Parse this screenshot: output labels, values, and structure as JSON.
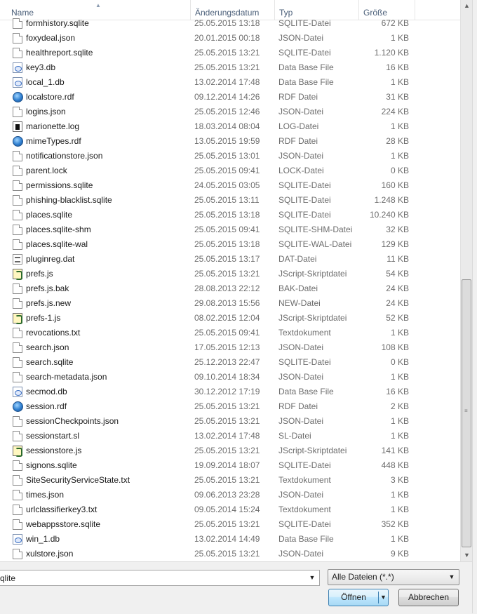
{
  "columns": {
    "name": "Name",
    "date": "Änderungsdatum",
    "type": "Typ",
    "size": "Größe"
  },
  "files": [
    {
      "name": "formhistory.sqlite",
      "date": "25.05.2015 13:18",
      "type": "SQLITE-Datei",
      "size": "672 KB",
      "icon": "doc-icon"
    },
    {
      "name": "foxydeal.json",
      "date": "20.01.2015 00:18",
      "type": "JSON-Datei",
      "size": "1 KB",
      "icon": "doc-icon"
    },
    {
      "name": "healthreport.sqlite",
      "date": "25.05.2015 13:21",
      "type": "SQLITE-Datei",
      "size": "1.120 KB",
      "icon": "doc-icon"
    },
    {
      "name": "key3.db",
      "date": "25.05.2015 13:21",
      "type": "Data Base File",
      "size": "16 KB",
      "icon": "database-file-icon"
    },
    {
      "name": "local_1.db",
      "date": "13.02.2014 17:48",
      "type": "Data Base File",
      "size": "1 KB",
      "icon": "database-file-icon"
    },
    {
      "name": "localstore.rdf",
      "date": "09.12.2014 14:26",
      "type": "RDF Datei",
      "size": "31 KB",
      "icon": "rdf-globe-icon"
    },
    {
      "name": "logins.json",
      "date": "25.05.2015 12:46",
      "type": "JSON-Datei",
      "size": "224 KB",
      "icon": "doc-icon"
    },
    {
      "name": "marionette.log",
      "date": "18.03.2014 08:04",
      "type": "LOG-Datei",
      "size": "1 KB",
      "icon": "log-file-icon"
    },
    {
      "name": "mimeTypes.rdf",
      "date": "13.05.2015 19:59",
      "type": "RDF Datei",
      "size": "28 KB",
      "icon": "rdf-globe-icon"
    },
    {
      "name": "notificationstore.json",
      "date": "25.05.2015 13:01",
      "type": "JSON-Datei",
      "size": "1 KB",
      "icon": "doc-icon"
    },
    {
      "name": "parent.lock",
      "date": "25.05.2015 09:41",
      "type": "LOCK-Datei",
      "size": "0 KB",
      "icon": "doc-icon"
    },
    {
      "name": "permissions.sqlite",
      "date": "24.05.2015 03:05",
      "type": "SQLITE-Datei",
      "size": "160 KB",
      "icon": "doc-icon"
    },
    {
      "name": "phishing-blacklist.sqlite",
      "date": "25.05.2015 13:11",
      "type": "SQLITE-Datei",
      "size": "1.248 KB",
      "icon": "doc-icon"
    },
    {
      "name": "places.sqlite",
      "date": "25.05.2015 13:18",
      "type": "SQLITE-Datei",
      "size": "10.240 KB",
      "icon": "doc-icon"
    },
    {
      "name": "places.sqlite-shm",
      "date": "25.05.2015 09:41",
      "type": "SQLITE-SHM-Datei",
      "size": "32 KB",
      "icon": "doc-icon"
    },
    {
      "name": "places.sqlite-wal",
      "date": "25.05.2015 13:18",
      "type": "SQLITE-WAL-Datei",
      "size": "129 KB",
      "icon": "doc-icon"
    },
    {
      "name": "pluginreg.dat",
      "date": "25.05.2015 13:17",
      "type": "DAT-Datei",
      "size": "11 KB",
      "icon": "dat-file-icon"
    },
    {
      "name": "prefs.js",
      "date": "25.05.2015 13:21",
      "type": "JScript-Skriptdatei",
      "size": "54 KB",
      "icon": "jscript-file-icon"
    },
    {
      "name": "prefs.js.bak",
      "date": "28.08.2013 22:12",
      "type": "BAK-Datei",
      "size": "24 KB",
      "icon": "doc-icon"
    },
    {
      "name": "prefs.js.new",
      "date": "29.08.2013 15:56",
      "type": "NEW-Datei",
      "size": "24 KB",
      "icon": "doc-icon"
    },
    {
      "name": "prefs-1.js",
      "date": "08.02.2015 12:04",
      "type": "JScript-Skriptdatei",
      "size": "52 KB",
      "icon": "jscript-file-icon"
    },
    {
      "name": "revocations.txt",
      "date": "25.05.2015 09:41",
      "type": "Textdokument",
      "size": "1 KB",
      "icon": "doc-icon"
    },
    {
      "name": "search.json",
      "date": "17.05.2015 12:13",
      "type": "JSON-Datei",
      "size": "108 KB",
      "icon": "doc-icon"
    },
    {
      "name": "search.sqlite",
      "date": "25.12.2013 22:47",
      "type": "SQLITE-Datei",
      "size": "0 KB",
      "icon": "doc-icon"
    },
    {
      "name": "search-metadata.json",
      "date": "09.10.2014 18:34",
      "type": "JSON-Datei",
      "size": "1 KB",
      "icon": "doc-icon"
    },
    {
      "name": "secmod.db",
      "date": "30.12.2012 17:19",
      "type": "Data Base File",
      "size": "16 KB",
      "icon": "database-file-icon"
    },
    {
      "name": "session.rdf",
      "date": "25.05.2015 13:21",
      "type": "RDF Datei",
      "size": "2 KB",
      "icon": "rdf-globe-icon"
    },
    {
      "name": "sessionCheckpoints.json",
      "date": "25.05.2015 13:21",
      "type": "JSON-Datei",
      "size": "1 KB",
      "icon": "doc-icon"
    },
    {
      "name": "sessionstart.sl",
      "date": "13.02.2014 17:48",
      "type": "SL-Datei",
      "size": "1 KB",
      "icon": "doc-icon"
    },
    {
      "name": "sessionstore.js",
      "date": "25.05.2015 13:21",
      "type": "JScript-Skriptdatei",
      "size": "141 KB",
      "icon": "jscript-file-icon"
    },
    {
      "name": "signons.sqlite",
      "date": "19.09.2014 18:07",
      "type": "SQLITE-Datei",
      "size": "448 KB",
      "icon": "doc-icon"
    },
    {
      "name": "SiteSecurityServiceState.txt",
      "date": "25.05.2015 13:21",
      "type": "Textdokument",
      "size": "3 KB",
      "icon": "doc-icon"
    },
    {
      "name": "times.json",
      "date": "09.06.2013 23:28",
      "type": "JSON-Datei",
      "size": "1 KB",
      "icon": "doc-icon"
    },
    {
      "name": "urlclassifierkey3.txt",
      "date": "09.05.2014 15:24",
      "type": "Textdokument",
      "size": "1 KB",
      "icon": "doc-icon"
    },
    {
      "name": "webappsstore.sqlite",
      "date": "25.05.2015 13:21",
      "type": "SQLITE-Datei",
      "size": "352 KB",
      "icon": "doc-icon"
    },
    {
      "name": "win_1.db",
      "date": "13.02.2014 14:49",
      "type": "Data Base File",
      "size": "1 KB",
      "icon": "database-file-icon"
    },
    {
      "name": "xulstore.json",
      "date": "25.05.2015 13:21",
      "type": "JSON-Datei",
      "size": "9 KB",
      "icon": "doc-icon"
    }
  ],
  "filename_field": {
    "value": "qlite"
  },
  "filetype_select": {
    "selected": "Alle Dateien (*.*)"
  },
  "buttons": {
    "open": "Öffnen",
    "cancel": "Abbrechen"
  },
  "icons": {
    "sort": "sort-ascending-icon",
    "close": "close-icon",
    "scroll_up": "scroll-up-icon",
    "scroll_down": "scroll-down-icon",
    "dropdown": "chevron-down-icon"
  },
  "colors": {
    "header_text": "#4c607a",
    "meta_text": "#6d6d6d",
    "accent_button": "#3c7fb1"
  }
}
